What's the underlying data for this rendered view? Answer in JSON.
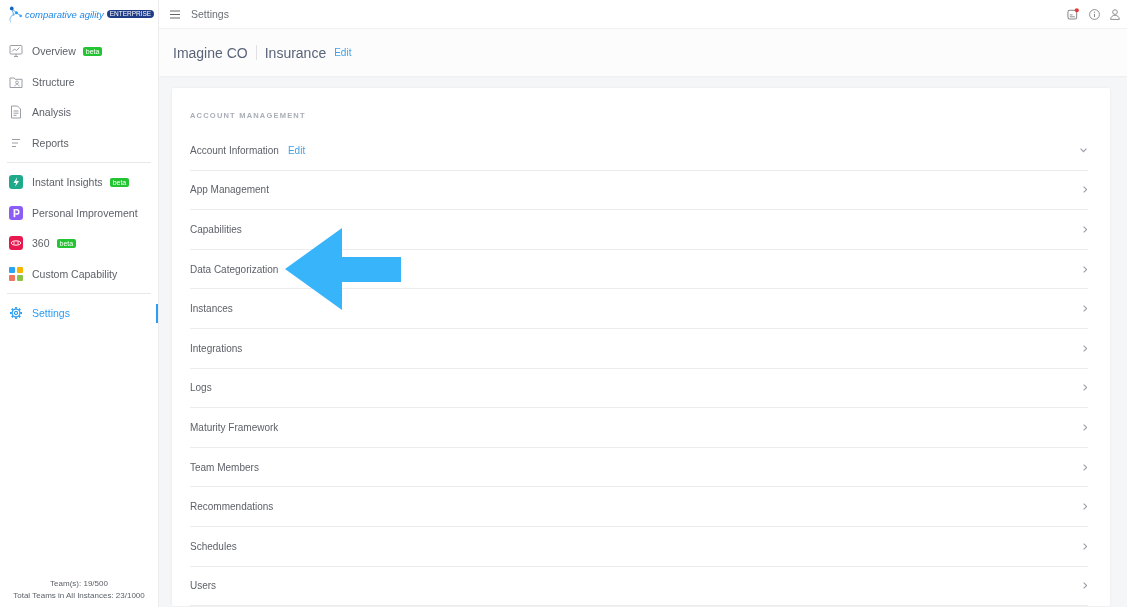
{
  "logo": {
    "name": "comparative agility",
    "edition": "ENTERPRISE"
  },
  "topbar": {
    "title": "Settings",
    "unread_notification": true
  },
  "sidebar": {
    "sections": [
      {
        "items": [
          {
            "label": "Overview",
            "badge": "beta",
            "selected": false
          },
          {
            "label": "Structure",
            "selected": false
          },
          {
            "label": "Analysis",
            "selected": false
          },
          {
            "label": "Reports",
            "selected": false
          }
        ]
      },
      {
        "items": [
          {
            "label": "Instant Insights",
            "badge": "beta",
            "selected": false
          },
          {
            "label": "Personal Improvement",
            "selected": false
          },
          {
            "label": "360",
            "badge": "beta",
            "selected": false
          },
          {
            "label": "Custom Capability",
            "selected": false
          }
        ]
      },
      {
        "items": [
          {
            "label": "Settings",
            "selected": true
          }
        ]
      }
    ],
    "footer": [
      "Team(s): 19/500",
      "Total Teams in All Instances: 23/1000"
    ]
  },
  "header": {
    "organization": "Imagine CO",
    "workspace": "Insurance",
    "action": "Edit"
  },
  "card": {
    "title": "ACCOUNT MANAGEMENT",
    "rows": [
      {
        "label": "Account Information",
        "kind": "expandable",
        "action": "Edit",
        "arrow": false
      },
      {
        "label": "App Management",
        "kind": "link",
        "arrow": false
      },
      {
        "label": "Capabilities",
        "kind": "link",
        "arrow": false
      },
      {
        "label": "Data Categorization",
        "kind": "link",
        "arrow": true
      },
      {
        "label": "Instances",
        "kind": "link",
        "arrow": false
      },
      {
        "label": "Integrations",
        "kind": "link",
        "arrow": false
      },
      {
        "label": "Logs",
        "kind": "link",
        "arrow": false
      },
      {
        "label": "Maturity Framework",
        "kind": "link",
        "arrow": false
      },
      {
        "label": "Team Members",
        "kind": "link",
        "arrow": false
      },
      {
        "label": "Recommendations",
        "kind": "link",
        "arrow": false
      },
      {
        "label": "Schedules",
        "kind": "link",
        "arrow": false
      },
      {
        "label": "Users",
        "kind": "link",
        "arrow": false
      }
    ]
  }
}
